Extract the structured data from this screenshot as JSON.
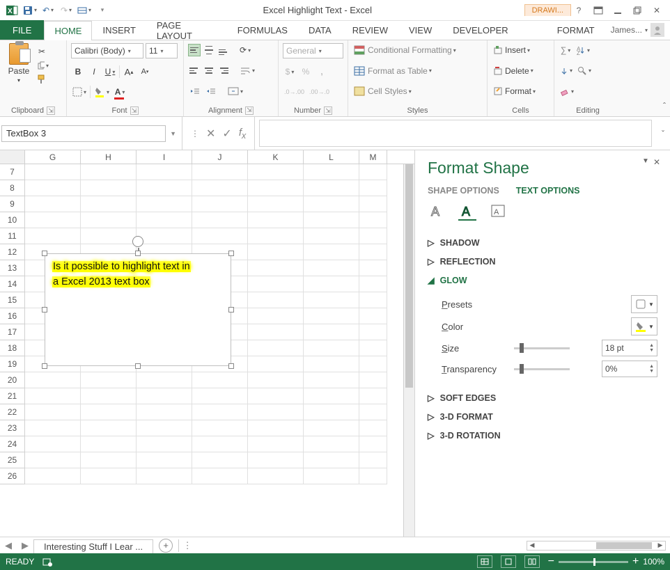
{
  "titlebar": {
    "title": "Excel Highlight Text - Excel",
    "tool_tab": "DRAWI...",
    "user": "James..."
  },
  "tabs": {
    "file": "FILE",
    "items": [
      "HOME",
      "INSERT",
      "PAGE LAYOUT",
      "FORMULAS",
      "DATA",
      "REVIEW",
      "VIEW",
      "DEVELOPER"
    ],
    "contextual": "FORMAT",
    "active": "HOME"
  },
  "ribbon": {
    "clipboard": {
      "label": "Clipboard",
      "paste": "Paste"
    },
    "font": {
      "label": "Font",
      "name": "Calibri (Body)",
      "size": "11",
      "bold": "B",
      "italic": "I",
      "underline": "U"
    },
    "alignment": {
      "label": "Alignment"
    },
    "number": {
      "label": "Number",
      "format": "General"
    },
    "styles": {
      "label": "Styles",
      "cond": "Conditional Formatting",
      "table": "Format as Table",
      "cell": "Cell Styles"
    },
    "cells": {
      "label": "Cells",
      "insert": "Insert",
      "delete": "Delete",
      "format": "Format"
    },
    "editing": {
      "label": "Editing"
    }
  },
  "namebox": {
    "value": "TextBox 3"
  },
  "sheet": {
    "columns": [
      "G",
      "H",
      "I",
      "J",
      "K",
      "L",
      "M"
    ],
    "row_start": 7,
    "row_end": 26,
    "textbox": {
      "line1": "Is it possible to highlight text in",
      "line2": "a Excel 2013 text box"
    }
  },
  "pane": {
    "title": "Format Shape",
    "tab_shape": "SHAPE OPTIONS",
    "tab_text": "TEXT OPTIONS",
    "sections": {
      "shadow": "SHADOW",
      "reflection": "REFLECTION",
      "glow": "GLOW",
      "softedges": "SOFT EDGES",
      "format3d": "3-D FORMAT",
      "rotation3d": "3-D ROTATION"
    },
    "glow": {
      "presets": "Presets",
      "color": "Color",
      "size_label": "Size",
      "size_value": "18 pt",
      "trans_label": "Transparency",
      "trans_value": "0%"
    }
  },
  "sheettabs": {
    "active": "Interesting Stuff I Lear ..."
  },
  "status": {
    "ready": "READY",
    "zoom": "100%"
  }
}
